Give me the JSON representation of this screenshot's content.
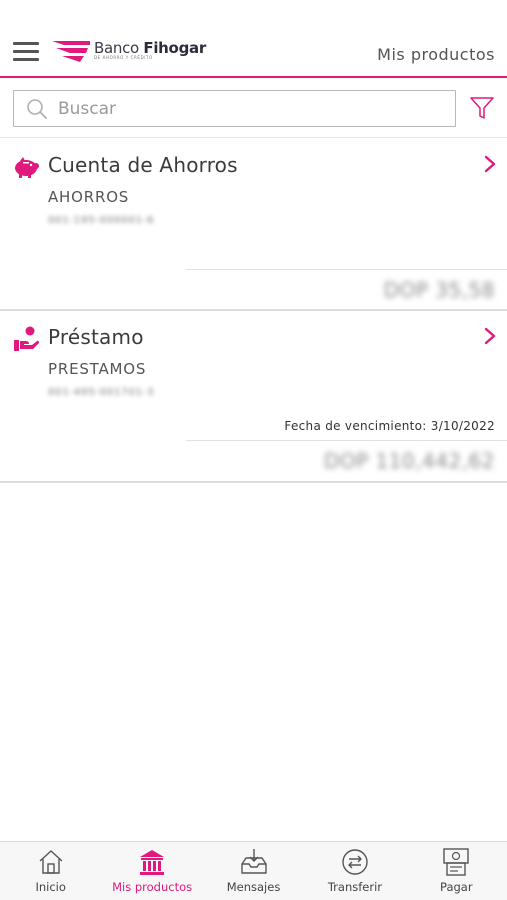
{
  "header": {
    "logo": {
      "brand_light": "Banco ",
      "brand_bold": "Fihogar",
      "tagline": "DE AHORRO Y CRÉDITO"
    },
    "title": "Mis productos"
  },
  "search": {
    "placeholder": "Buscar",
    "value": ""
  },
  "products": [
    {
      "name": "Cuenta de Ahorros",
      "type": "AHORROS",
      "number": "001-195-000001-6",
      "due_date": "",
      "balance": "DOP 35,58",
      "icon": "piggy-bank-icon"
    },
    {
      "name": "Préstamo",
      "type": "PRESTAMOS",
      "number": "001-495-001701-3",
      "due_date": "Fecha de vencimiento: 3/10/2022",
      "balance": "DOP 110,442,62",
      "icon": "loan-hand-icon"
    }
  ],
  "tabbar": {
    "items": [
      {
        "label": "Inicio",
        "icon": "home-icon",
        "active": false
      },
      {
        "label": "Mis productos",
        "icon": "bank-icon",
        "active": true
      },
      {
        "label": "Mensajes",
        "icon": "inbox-icon",
        "active": false
      },
      {
        "label": "Transferir",
        "icon": "transfer-icon",
        "active": false
      },
      {
        "label": "Pagar",
        "icon": "pay-icon",
        "active": false
      }
    ]
  },
  "colors": {
    "accent": "#e0197d",
    "text": "#3b3b3b",
    "muted": "#9a9a9a",
    "divider": "#dcdcdc",
    "tabbar_bg": "#f7f7f7"
  }
}
